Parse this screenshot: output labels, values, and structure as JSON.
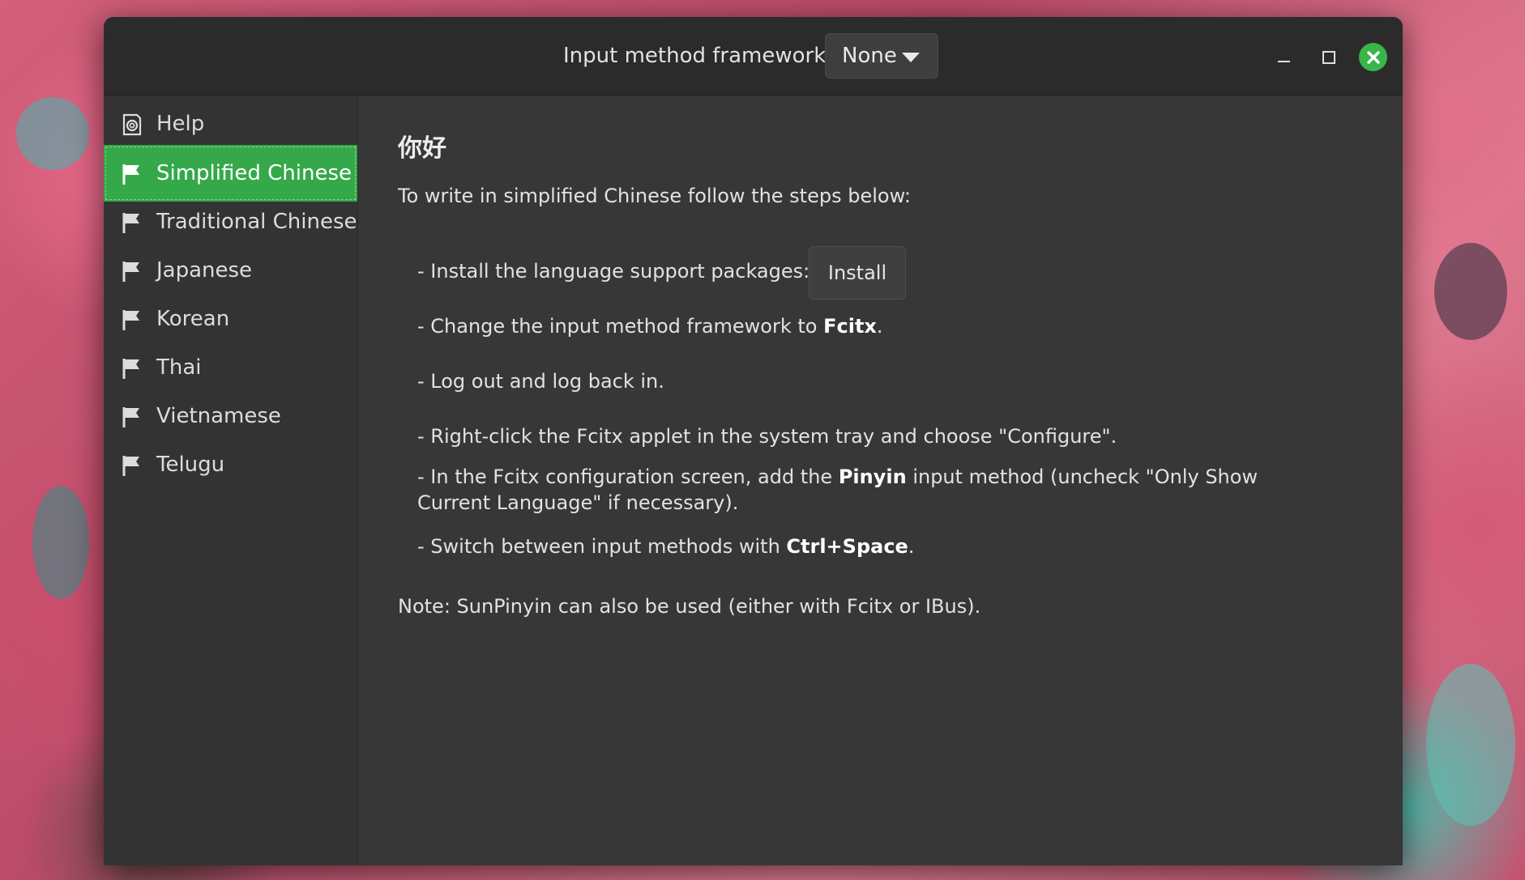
{
  "header": {
    "framework_label": "Input method framework:",
    "framework_value": "None"
  },
  "window_controls": {
    "minimize_icon": "minimize-icon",
    "maximize_icon": "maximize-icon",
    "close_icon": "close-icon",
    "close_color": "#39b54a"
  },
  "sidebar": {
    "items": [
      {
        "label": "Help",
        "icon": "help-icon"
      },
      {
        "label": "Simplified Chinese",
        "icon": "flag-icon",
        "active": true
      },
      {
        "label": "Traditional Chinese",
        "icon": "flag-icon"
      },
      {
        "label": "Japanese",
        "icon": "flag-icon"
      },
      {
        "label": "Korean",
        "icon": "flag-icon"
      },
      {
        "label": "Thai",
        "icon": "flag-icon"
      },
      {
        "label": "Vietnamese",
        "icon": "flag-icon"
      },
      {
        "label": "Telugu",
        "icon": "flag-icon"
      }
    ],
    "active_color": "#35a94a"
  },
  "content": {
    "heading": "你好",
    "intro": "To write in simplified Chinese follow the steps below:",
    "step1": "- Install the language support packages:",
    "install_label": "Install",
    "step2_pre": "- Change the input method framework to ",
    "step2_bold": "Fcitx",
    "step2_post": ".",
    "step3": "- Log out and log back in.",
    "step4": "- Right-click the Fcitx applet in the system tray and choose \"Configure\".",
    "step5_pre": "- In the Fcitx configuration screen, add the ",
    "step5_bold": "Pinyin",
    "step5_post": " input method (uncheck \"Only Show Current Language\" if necessary).",
    "step6_pre": "- Switch between input methods with ",
    "step6_bold": "Ctrl+Space",
    "step6_post": ".",
    "note": "Note: SunPinyin can also be used (either with Fcitx or IBus)."
  }
}
